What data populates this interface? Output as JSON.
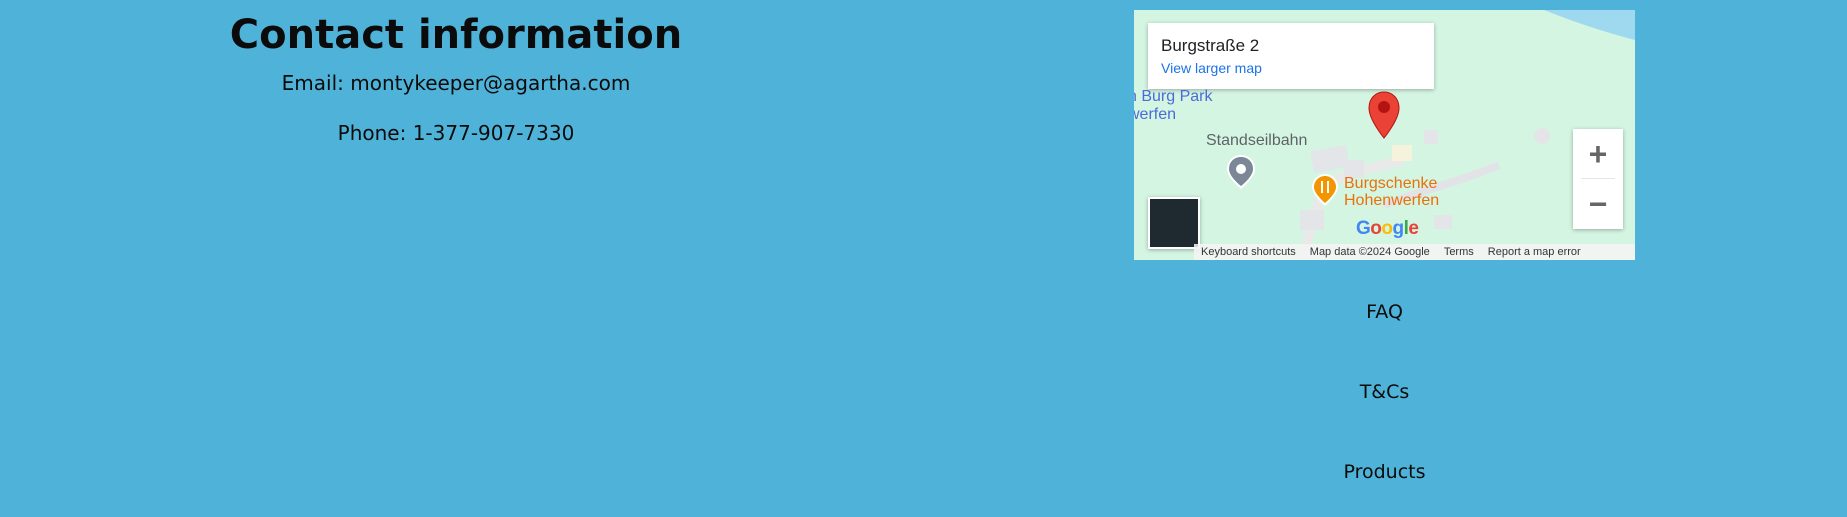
{
  "contact": {
    "title": "Contact information",
    "email": "Email: montykeeper@agartha.com",
    "phone": "Phone: 1-377-907-7330"
  },
  "map": {
    "place_name": "Burgstraße 2",
    "view_larger": "View larger map",
    "labels": {
      "park_line1": "n Burg Park",
      "park_line2": "werfen",
      "standseilbahn": "Standseilbahn",
      "burgschenke_line1": "Burgschenke",
      "burgschenke_line2": "Hohenwerfen"
    },
    "logo": [
      "G",
      "o",
      "o",
      "g",
      "l",
      "e"
    ],
    "attribution": {
      "shortcuts": "Keyboard shortcuts",
      "map_data": "Map data ©2024 Google",
      "terms": "Terms",
      "report": "Report a map error"
    },
    "zoom_in": "+",
    "zoom_out": "−"
  },
  "nav_links": {
    "faq": "FAQ",
    "tcs": "T&Cs",
    "products": "Products"
  },
  "colors": {
    "background": "#4fb3d9",
    "map_land": "#d4f5e2",
    "pin": "#ea4335",
    "link": "#1a73e8"
  }
}
